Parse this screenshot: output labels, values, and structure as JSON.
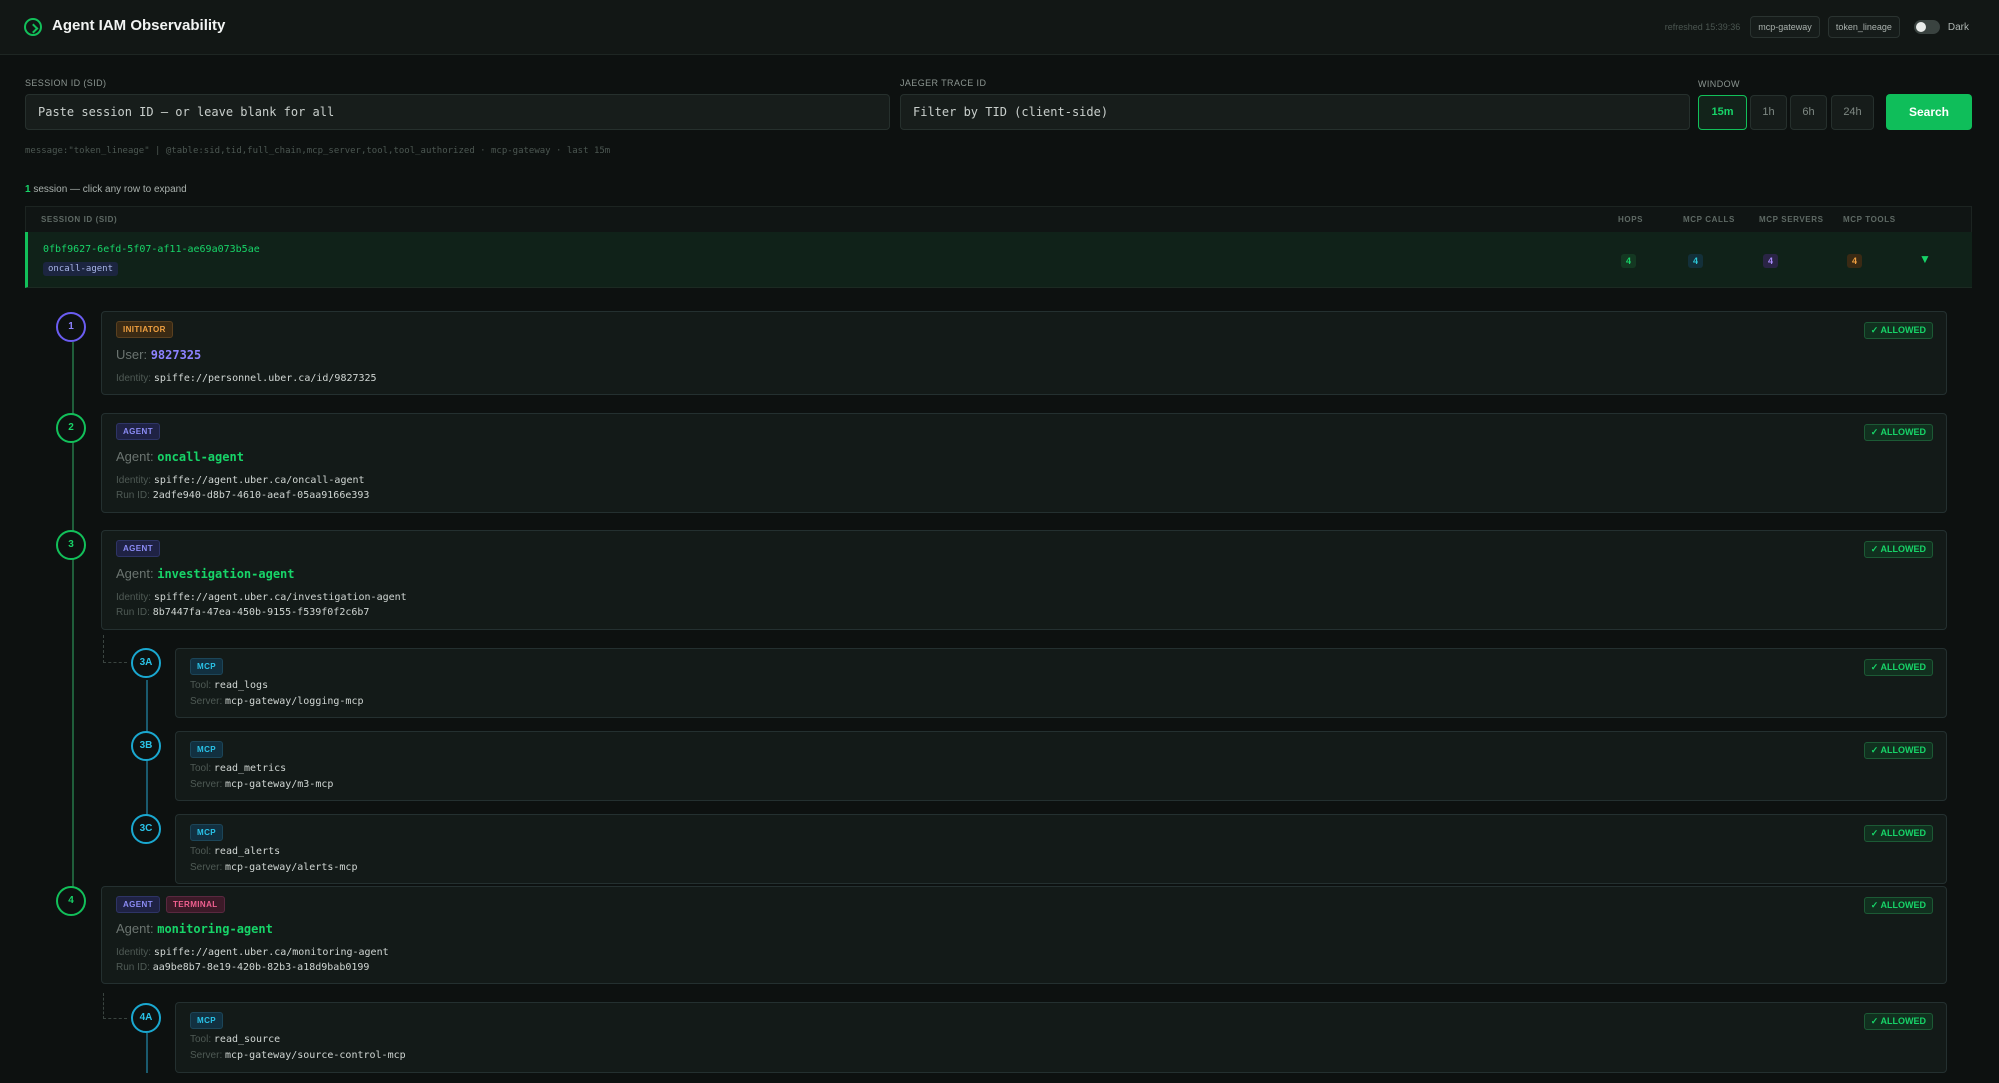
{
  "header": {
    "title": "Agent IAM Observability",
    "refreshed": "refreshed 15:39:36",
    "chips": [
      "mcp-gateway",
      "token_lineage"
    ],
    "theme_label": "Dark"
  },
  "search": {
    "sid_label": "SESSION ID (SID)",
    "sid_placeholder": "Paste session ID — or leave blank for all",
    "tid_label": "JAEGER TRACE ID",
    "tid_placeholder": "Filter by TID (client-side)",
    "window_label": "WINDOW",
    "windows": [
      "15m",
      "1h",
      "6h",
      "24h"
    ],
    "active_window": "15m",
    "search_button": "Search",
    "query": "message:\"token_lineage\" | @table:sid,tid,full_chain,mcp_server,tool,tool_authorized · mcp-gateway · last 15m"
  },
  "results": {
    "count": "1",
    "count_suffix": "session — click any row to expand"
  },
  "table": {
    "columns": [
      "SESSION ID (SID)",
      "HOPS",
      "MCP CALLS",
      "MCP SERVERS",
      "MCP TOOLS"
    ],
    "row": {
      "sid": "0fbf9627-6efd-5f07-af11-ae69a073b5ae",
      "tag": "oncall-agent",
      "hops": "4",
      "mcp_calls": "4",
      "mcp_servers": "4",
      "mcp_tools": "4",
      "expand_icon": "▼"
    }
  },
  "status_label": "✓ ALLOWED",
  "labels": {
    "identity": "Identity:",
    "run_id": "Run ID:",
    "tool": "Tool:",
    "server": "Server:",
    "user_prefix": "User:",
    "agent_prefix": "Agent:"
  },
  "hops": [
    {
      "step": "1",
      "badges": [
        "INITIATOR"
      ],
      "name": "9827325",
      "identity": "spiffe://personnel.uber.ca/id/9827325"
    },
    {
      "step": "2",
      "badges": [
        "AGENT"
      ],
      "name": "oncall-agent",
      "identity": "spiffe://agent.uber.ca/oncall-agent",
      "run_id": "2adfe940-d8b7-4610-aeaf-05aa9166e393"
    },
    {
      "step": "3",
      "badges": [
        "AGENT"
      ],
      "name": "investigation-agent",
      "identity": "spiffe://agent.uber.ca/investigation-agent",
      "run_id": "8b7447fa-47ea-450b-9155-f539f0f2c6b7"
    },
    {
      "step": "3A",
      "badges": [
        "MCP"
      ],
      "tool": "read_logs",
      "server": "mcp-gateway/logging-mcp"
    },
    {
      "step": "3B",
      "badges": [
        "MCP"
      ],
      "tool": "read_metrics",
      "server": "mcp-gateway/m3-mcp"
    },
    {
      "step": "3C",
      "badges": [
        "MCP"
      ],
      "tool": "read_alerts",
      "server": "mcp-gateway/alerts-mcp"
    },
    {
      "step": "4",
      "badges": [
        "AGENT",
        "TERMINAL"
      ],
      "name": "monitoring-agent",
      "identity": "spiffe://agent.uber.ca/monitoring-agent",
      "run_id": "aa9be8b7-8e19-420b-82b3-a18d9bab0199"
    },
    {
      "step": "4A",
      "badges": [
        "MCP"
      ],
      "tool": "read_source",
      "server": "mcp-gateway/source-control-mcp"
    }
  ],
  "colors": {
    "accent": "#12c05a",
    "background": "#0d1110",
    "mcp": "#2ac3e8",
    "initiator": "#6b5df2"
  }
}
